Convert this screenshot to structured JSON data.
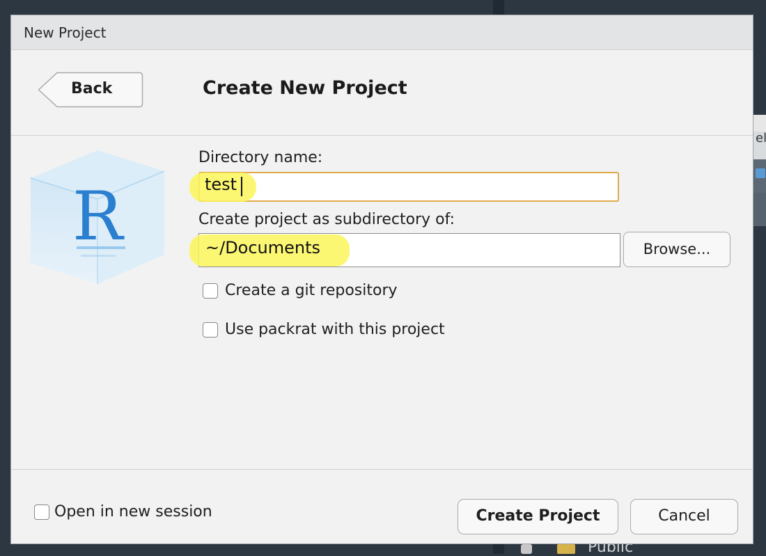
{
  "background": {
    "right_text": "el",
    "bottom_label": "Public"
  },
  "dialog": {
    "title": "New Project",
    "back_label": "Back",
    "heading": "Create New Project",
    "logo_letter": "R",
    "directory_label": "Directory name:",
    "directory_value": "test",
    "subdir_label": "Create project as subdirectory of:",
    "subdir_value": "~/Documents",
    "browse_label": "Browse...",
    "git_label": "Create a git repository",
    "packrat_label": "Use packrat with this project",
    "new_session_label": "Open in new session",
    "create_label": "Create Project",
    "cancel_label": "Cancel"
  },
  "colors": {
    "highlight": "#fbf65a",
    "focus_border": "#e0a84a",
    "r_blue": "#2b7fd0"
  }
}
